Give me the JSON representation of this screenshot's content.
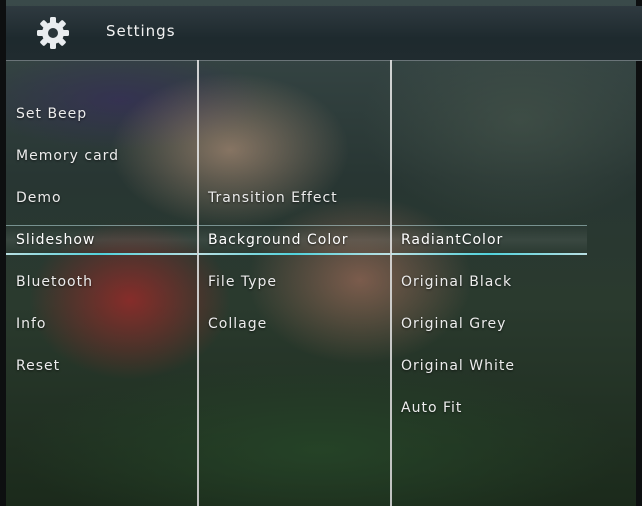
{
  "header": {
    "title": "Settings",
    "icon": "gear-icon"
  },
  "columns": {
    "main_menu": [
      {
        "label": "Set Beep"
      },
      {
        "label": "Memory card"
      },
      {
        "label": "Demo"
      },
      {
        "label": "Slideshow",
        "selected": true
      },
      {
        "label": "Bluetooth"
      },
      {
        "label": "Info"
      },
      {
        "label": "Reset"
      }
    ],
    "slideshow_menu": [
      {
        "label": "Transition Effect"
      },
      {
        "label": "Background Color",
        "selected": true
      },
      {
        "label": "File Type"
      },
      {
        "label": "Collage"
      }
    ],
    "background_color_options": [
      {
        "label": "RadiantColor",
        "selected": true
      },
      {
        "label": "Original Black"
      },
      {
        "label": "Original Grey"
      },
      {
        "label": "Original White"
      },
      {
        "label": "Auto Fit"
      }
    ]
  },
  "colors": {
    "highlight_line": "#50d2dc",
    "text": "#ececec"
  }
}
